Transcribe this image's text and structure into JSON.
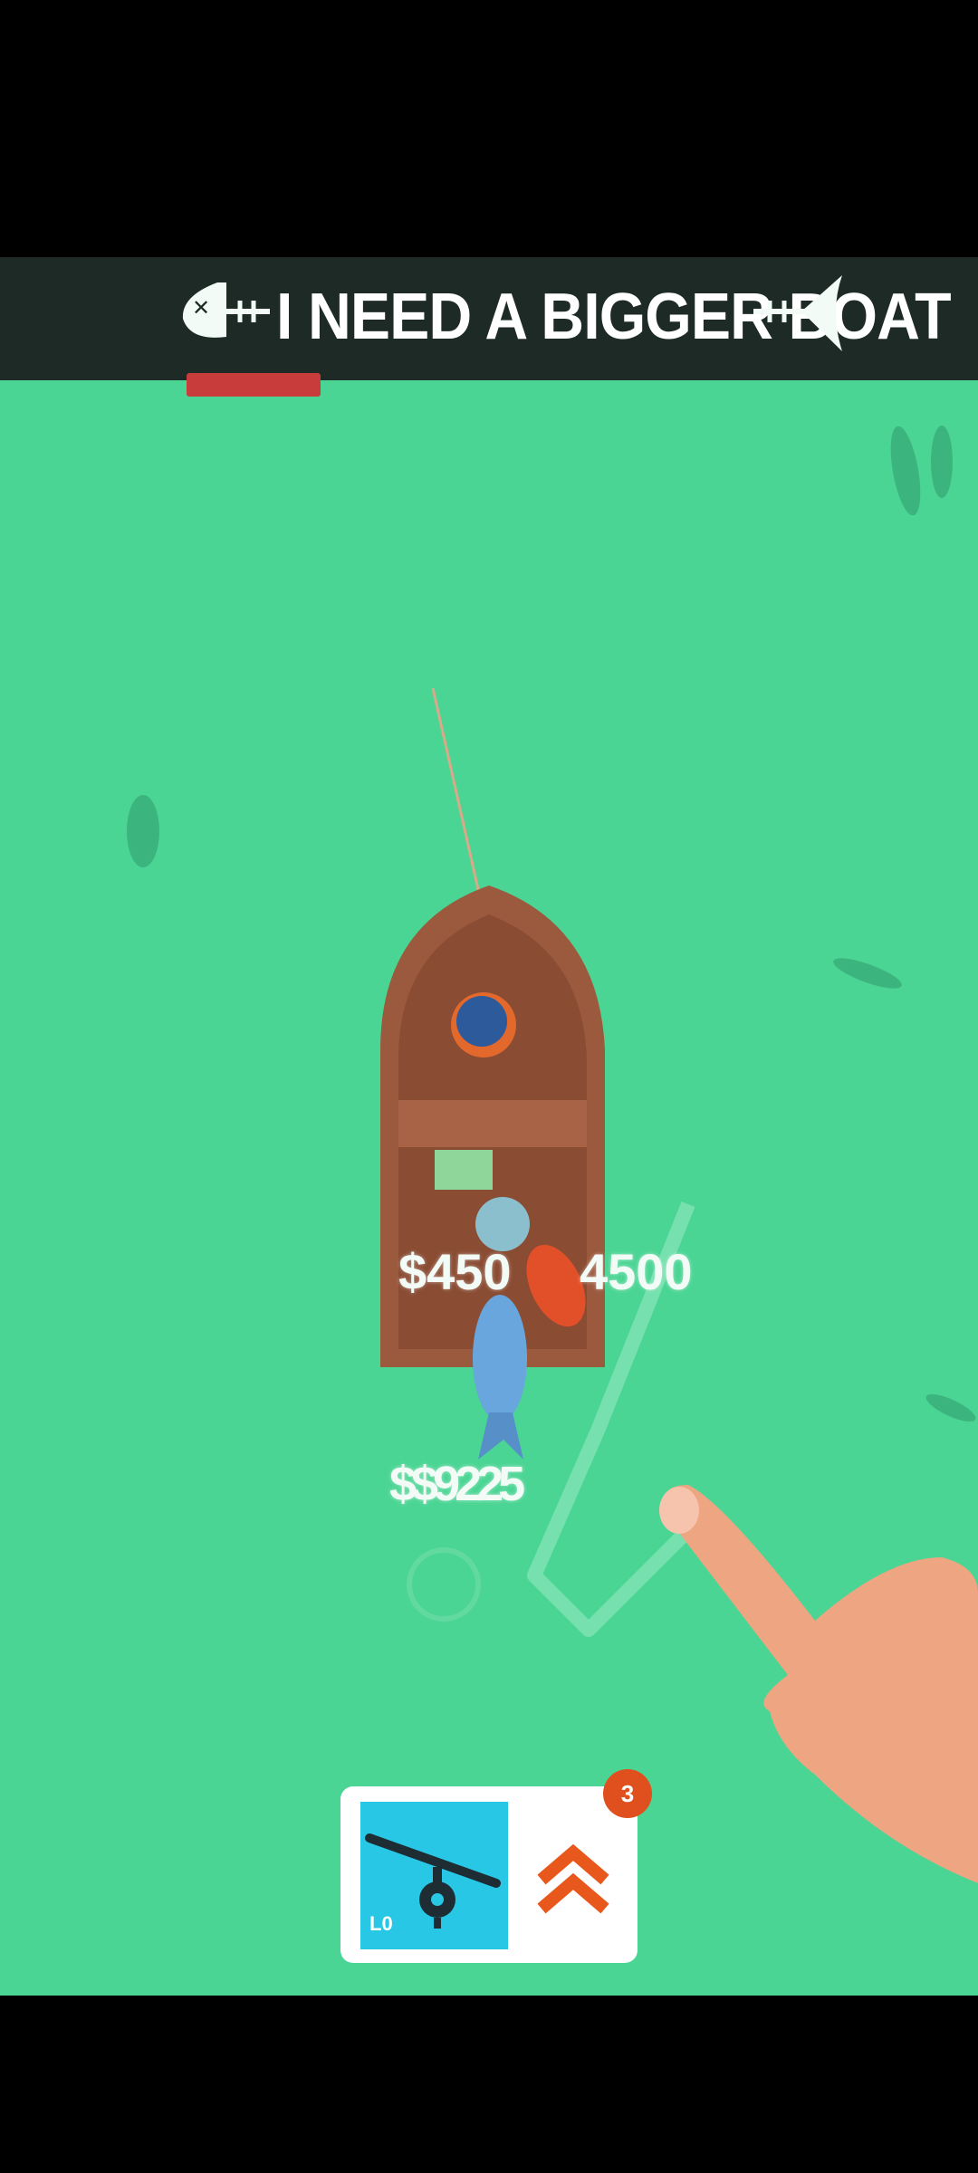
{
  "game": {
    "title": "I NEED A BIGGER BOAT",
    "colors": {
      "water": "#4bd594",
      "banner": "#1d2a26",
      "boat": "#9b5a3e",
      "rod_tile": "#29c7e6",
      "badge": "#e0501e",
      "upgrade_arrow": "#e8581c"
    }
  },
  "floating_values": {
    "left": "$450",
    "right": "4500",
    "lower": "$$9225"
  },
  "upgrade_card": {
    "rod_level": "L0",
    "badge_count": "3",
    "icons": [
      "fishing-rod-icon",
      "double-chevron-up-icon"
    ]
  },
  "scene": {
    "icons": [
      "fish-skeleton-icon",
      "boat",
      "fisherman",
      "fish",
      "pointing-hand"
    ]
  }
}
